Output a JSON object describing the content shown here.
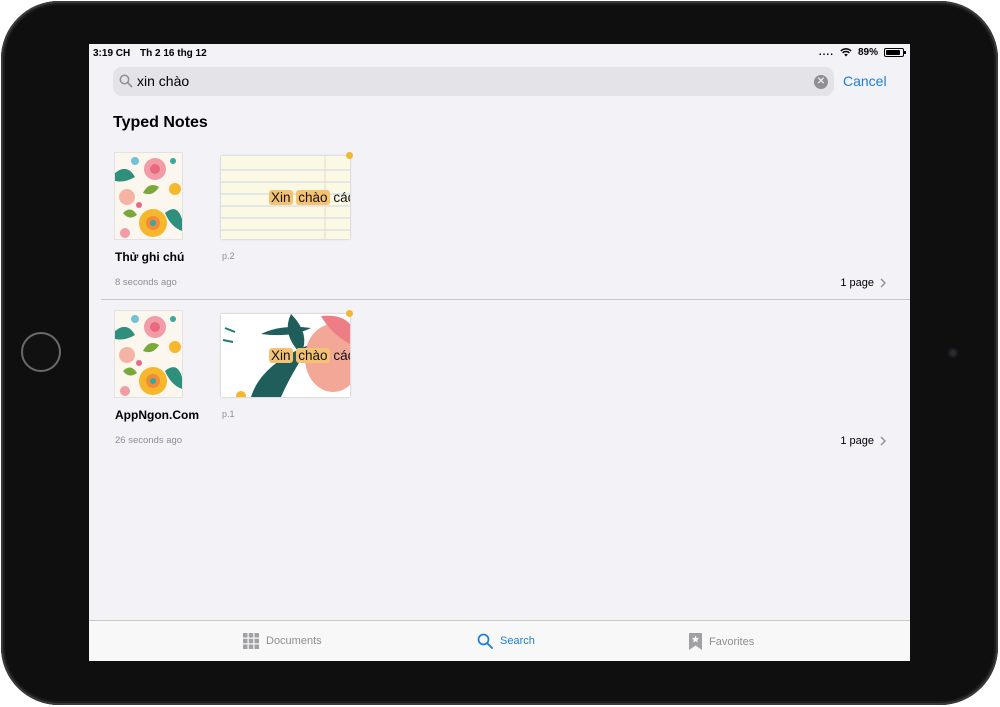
{
  "status_bar": {
    "time": "3:19 CH",
    "date": "Th 2 16 thg 12",
    "signal_dots": "....",
    "battery": "89%",
    "battery_level": 0.89
  },
  "search": {
    "query": "xin chào",
    "cancel_label": "Cancel"
  },
  "section_title": "Typed Notes",
  "results": [
    {
      "title": "Thử ghi chú",
      "time": "8 seconds ago",
      "thumb_text": "Xin chào các",
      "highlights": [
        "Xin",
        "chào"
      ],
      "page_label": "p.2",
      "page_count": "1 page"
    },
    {
      "title": "AppNgon.Com",
      "time": "26 seconds ago",
      "thumb_text": "Xin chào các",
      "highlights": [
        "Xin",
        "chào"
      ],
      "page_label": "p.1",
      "page_count": "1 page"
    }
  ],
  "tabs": [
    {
      "label": "Documents",
      "icon": "grid-icon",
      "active": false
    },
    {
      "label": "Search",
      "icon": "magnifier-icon",
      "active": true
    },
    {
      "label": "Favorites",
      "icon": "bookmark-star-icon",
      "active": false
    }
  ],
  "colors": {
    "accent": "#1e7ed8",
    "highlight": "#f4c272",
    "background": "#f2f2f7"
  }
}
